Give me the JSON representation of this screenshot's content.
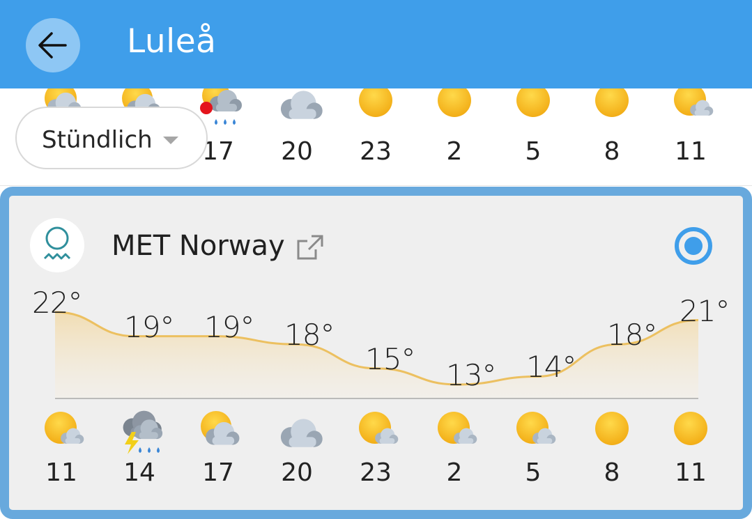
{
  "appbar": {
    "title": "Luleå",
    "back_icon": "arrow-left-icon",
    "color": "#3f9eea"
  },
  "mode_selector": {
    "label": "Stündlich",
    "icon": "chevron-down-icon"
  },
  "top_forecast": [
    {
      "hour": "",
      "icon": "partly-cloudy-icon"
    },
    {
      "hour": "",
      "icon": "cloudy-sun-icon"
    },
    {
      "hour": "17",
      "icon": "rain-cloud-alert-icon"
    },
    {
      "hour": "20",
      "icon": "cloudy-icon"
    },
    {
      "hour": "23",
      "icon": "sun-icon"
    },
    {
      "hour": "2",
      "icon": "sun-icon"
    },
    {
      "hour": "5",
      "icon": "sun-icon"
    },
    {
      "hour": "8",
      "icon": "sun-icon"
    },
    {
      "hour": "11",
      "icon": "sun-small-cloud-icon"
    }
  ],
  "provider": {
    "name": "MET Norway",
    "logo_icon": "met-norway-logo-icon",
    "link_icon": "external-link-icon",
    "selected": true,
    "accent": "#3f9eea"
  },
  "chart_data": {
    "type": "area",
    "x": [
      "11",
      "14",
      "17",
      "20",
      "23",
      "2",
      "5",
      "8",
      "11"
    ],
    "values": [
      22,
      19,
      19,
      18,
      15,
      13,
      14,
      18,
      21
    ],
    "labels": [
      "22°",
      "19°",
      "19°",
      "18°",
      "15°",
      "13°",
      "14°",
      "18°",
      "21°"
    ],
    "line_color": "#ecc060",
    "fill_color": "#f3e2bd"
  },
  "bottom_forecast": [
    {
      "hour": "11",
      "icon": "sun-small-cloud-icon"
    },
    {
      "hour": "14",
      "icon": "thunderstorm-rain-icon"
    },
    {
      "hour": "17",
      "icon": "cloudy-sun-icon"
    },
    {
      "hour": "20",
      "icon": "cloudy-icon"
    },
    {
      "hour": "23",
      "icon": "sun-small-cloud-icon"
    },
    {
      "hour": "2",
      "icon": "sun-small-cloud-icon"
    },
    {
      "hour": "5",
      "icon": "sun-small-cloud-icon"
    },
    {
      "hour": "8",
      "icon": "sun-icon"
    },
    {
      "hour": "11",
      "icon": "sun-icon"
    }
  ]
}
